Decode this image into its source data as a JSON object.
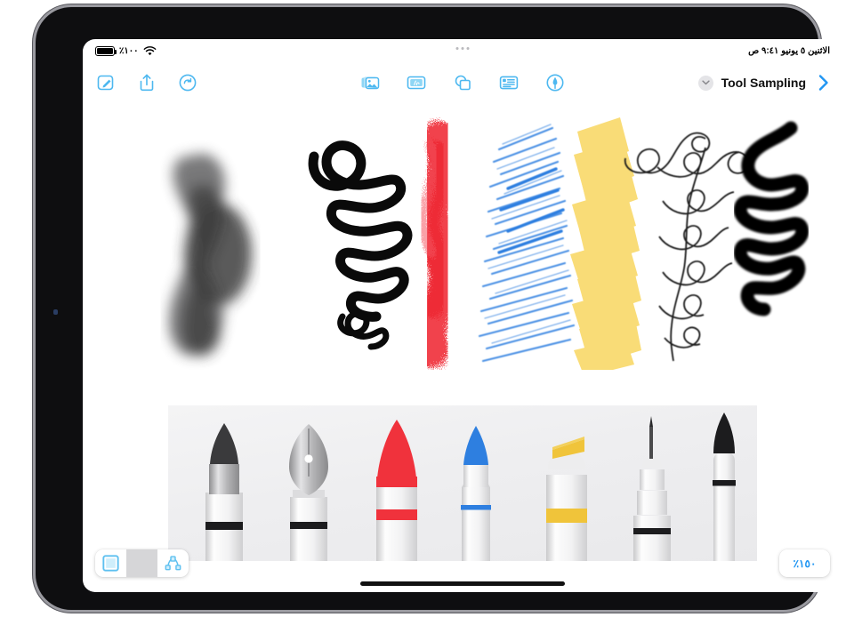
{
  "status_bar": {
    "battery_label": "٪١٠٠",
    "battery_icon": "battery-full-icon",
    "wifi_icon": "wifi-icon",
    "datetime": "الاثنين ٥ يونيو ٩:٤١ ص"
  },
  "toolbar": {
    "left_tools": [
      {
        "name": "markup-compose-icon",
        "label": "Markup"
      },
      {
        "name": "share-icon",
        "label": "Share"
      },
      {
        "name": "redo-icon",
        "label": "Redo"
      }
    ],
    "center_tools": [
      {
        "name": "media-library-icon",
        "label": "Media"
      },
      {
        "name": "sticker-icon",
        "label": "Sticker"
      },
      {
        "name": "shapes-icon",
        "label": "Shapes"
      },
      {
        "name": "text-box-icon",
        "label": "Text"
      },
      {
        "name": "drawing-tool-icon",
        "label": "Draw"
      }
    ],
    "document_title": "Tool Sampling",
    "chevron_down_icon": "chevron-down-icon",
    "forward_icon": "chevron-right-icon"
  },
  "bottom_bar": {
    "frame_button": {
      "name": "frame-grid-icon",
      "label": "Frame"
    },
    "nodes_button": {
      "name": "path-nodes-icon",
      "label": "Nodes"
    },
    "zoom_level": "٪١٥٠"
  },
  "canvas": {
    "strokes": [
      {
        "id": "stroke-watercolor-grey",
        "tool": "Brush",
        "color": "#5a5a5c"
      },
      {
        "id": "stroke-calligraphy-black",
        "tool": "Fountain Pen",
        "color": "#0a0a0a"
      },
      {
        "id": "stroke-crayon-red",
        "tool": "Crayon",
        "color": "#f0323c"
      },
      {
        "id": "stroke-pencil-blue",
        "tool": "Colored Pencil",
        "color": "#2e7fe0"
      },
      {
        "id": "stroke-highlighter-yellow",
        "tool": "Highlighter",
        "color": "#f7cf44"
      },
      {
        "id": "stroke-technical-black",
        "tool": "Technical Pen",
        "color": "#1a1a1a"
      },
      {
        "id": "stroke-marker-black",
        "tool": "Marker",
        "color": "#000000"
      }
    ],
    "tools": [
      {
        "id": "tool-brush",
        "label": "Brush",
        "tip_color": "#3a3a3c",
        "band_color": "#1c1c1e"
      },
      {
        "id": "tool-fountain-pen",
        "label": "Fountain Pen",
        "tip_color": "#b4b4b6",
        "band_color": "#1c1c1e"
      },
      {
        "id": "tool-crayon",
        "label": "Crayon",
        "tip_color": "#f0323c",
        "band_color": "#f0323c"
      },
      {
        "id": "tool-pencil",
        "label": "Colored Pencil",
        "tip_color": "#2e7fe0",
        "band_color": "#2e7fe0"
      },
      {
        "id": "tool-highlighter",
        "label": "Highlighter",
        "tip_color": "#f0c43a",
        "band_color": "#f0c43a"
      },
      {
        "id": "tool-technical-pen",
        "label": "Technical Pen",
        "tip_color": "#4a4a4c",
        "band_color": "#1c1c1e"
      },
      {
        "id": "tool-marker",
        "label": "Marker",
        "tip_color": "#1c1c1e",
        "band_color": "#1c1c1e"
      }
    ]
  }
}
